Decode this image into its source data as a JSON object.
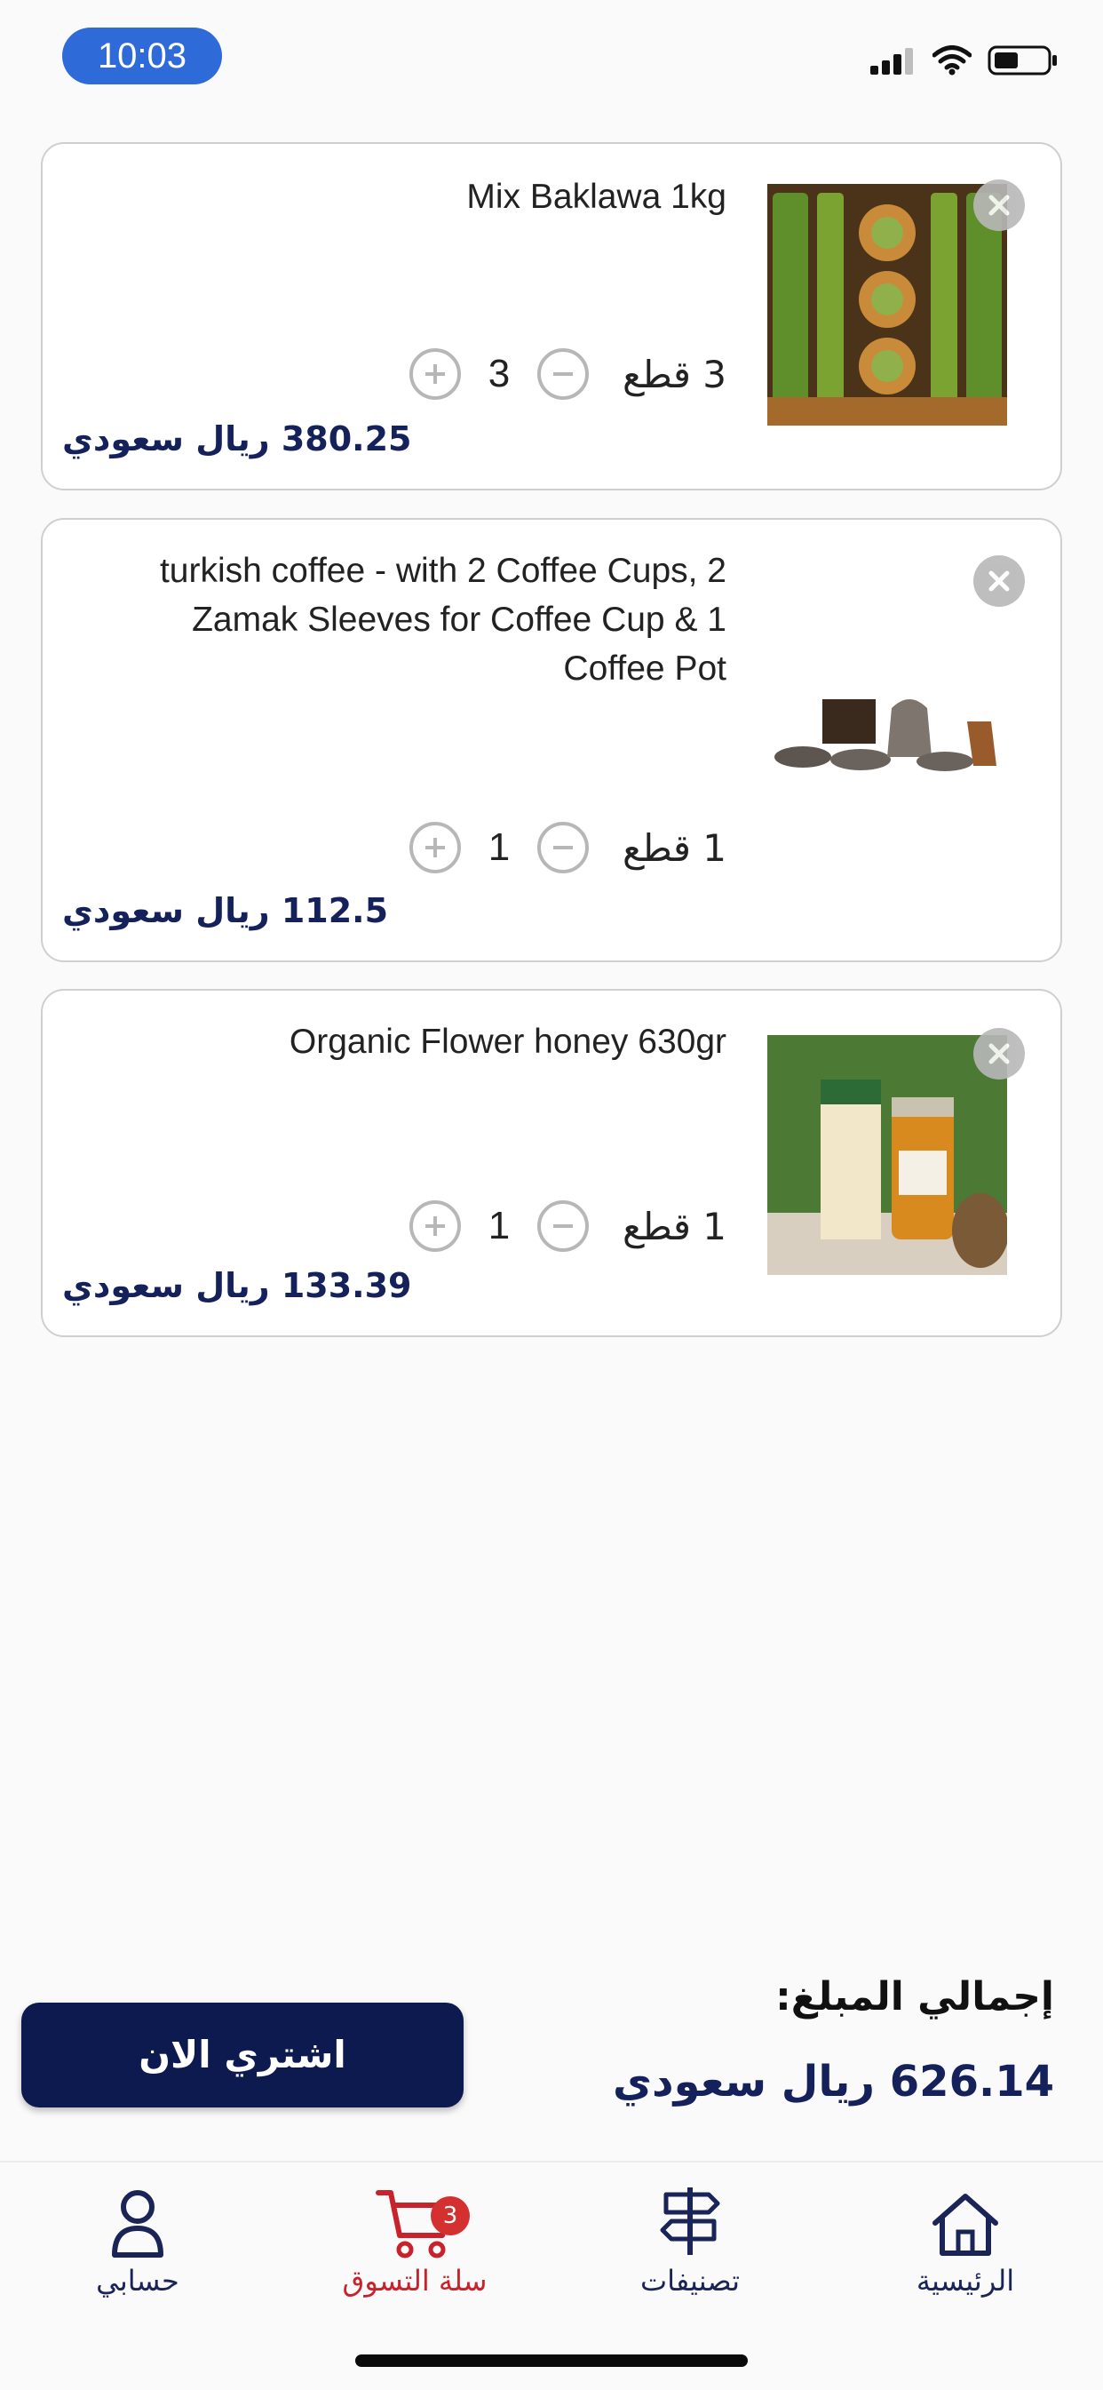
{
  "status_bar": {
    "time": "10:03"
  },
  "cart_items": [
    {
      "title": "Mix Baklawa 1kg",
      "quantity": "3",
      "quantity_label": "3 قطع",
      "price": "380.25 ريال سعودي"
    },
    {
      "title": "turkish coffee - with 2 Coffee Cups, 2 Zamak Sleeves for Coffee Cup & 1 Coffee Pot",
      "quantity": "1",
      "quantity_label": "1 قطع",
      "price": "112.5 ريال سعودي"
    },
    {
      "title": "Organic Flower honey 630gr",
      "quantity": "1",
      "quantity_label": "1 قطع",
      "price": "133.39 ريال سعودي"
    }
  ],
  "summary": {
    "total_label": "إجمالي المبلغ:",
    "total_value": "626.14 ريال سعودي",
    "buy_button": "اشتري الان"
  },
  "bottom_nav": {
    "account": "حسابي",
    "cart": "سلة التسوق",
    "cart_badge": "3",
    "categories": "تصنيفات",
    "home": "الرئيسية"
  },
  "colors": {
    "primary": "#0d1a4f",
    "accent": "#c8232c",
    "status_pill": "#2f6ad9"
  }
}
